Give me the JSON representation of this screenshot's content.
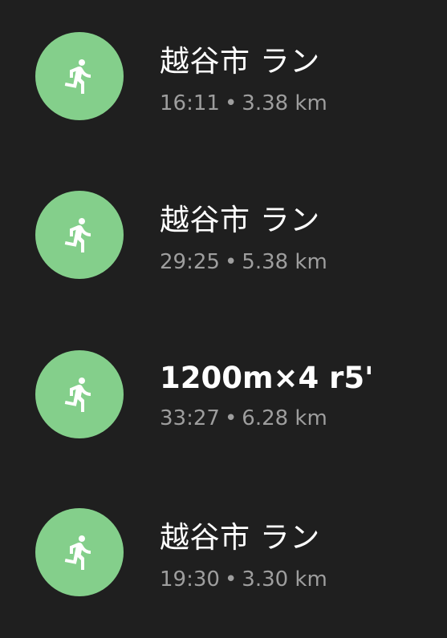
{
  "activities": [
    {
      "title": "越谷市 ラン",
      "duration": "16:11",
      "separator": "•",
      "distance": "3.38 km",
      "icon": "running-person-icon"
    },
    {
      "title": "越谷市 ラン",
      "duration": "29:25",
      "separator": "•",
      "distance": "5.38 km",
      "icon": "running-person-icon"
    },
    {
      "title": "1200m×4 r5'",
      "duration": "33:27",
      "separator": "•",
      "distance": "6.28 km",
      "icon": "running-person-icon"
    },
    {
      "title": "越谷市 ラン",
      "duration": "19:30",
      "separator": "•",
      "distance": "3.30 km",
      "icon": "running-person-icon"
    }
  ],
  "colors": {
    "background": "#1f1f1f",
    "icon_circle": "#84cf8b",
    "icon_glyph": "#ffffff",
    "title_text": "#ffffff",
    "subtitle_text": "#9e9e9e"
  }
}
